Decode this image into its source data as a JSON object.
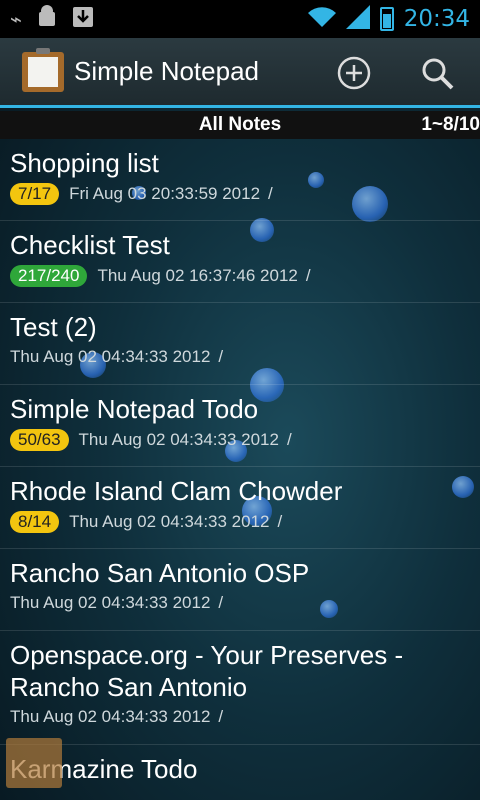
{
  "status_bar": {
    "time": "20:34",
    "icons": [
      "usb-icon",
      "android-debug-icon",
      "download-icon",
      "wifi-icon",
      "signal-icon",
      "battery-icon"
    ]
  },
  "app_bar": {
    "title": "Simple Notepad",
    "add_icon": "plus-circle-icon",
    "search_icon": "search-icon"
  },
  "list_header": {
    "title": "All Notes",
    "count": "1~8/10"
  },
  "notes": [
    {
      "title": "Shopping list",
      "badge": "7/17",
      "badge_color": "yellow",
      "date": "Fri Aug 03 20:33:59 2012",
      "suffix": "/"
    },
    {
      "title": "Checklist Test",
      "badge": "217/240",
      "badge_color": "green",
      "date": "Thu Aug 02 16:37:46 2012",
      "suffix": "/"
    },
    {
      "title": "Test (2)",
      "badge": "",
      "badge_color": "",
      "date": "Thu Aug 02 04:34:33 2012",
      "suffix": "/"
    },
    {
      "title": "Simple Notepad Todo",
      "badge": "50/63",
      "badge_color": "yellow",
      "date": "Thu Aug 02 04:34:33 2012",
      "suffix": "/"
    },
    {
      "title": "Rhode Island Clam Chowder",
      "badge": "8/14",
      "badge_color": "yellow",
      "date": "Thu Aug 02 04:34:33 2012",
      "suffix": "/"
    },
    {
      "title": "Rancho San Antonio OSP",
      "badge": "",
      "badge_color": "",
      "date": "Thu Aug 02 04:34:33 2012",
      "suffix": "/"
    },
    {
      "title": "Openspace.org - Your Preserves - Rancho San Antonio",
      "badge": "",
      "badge_color": "",
      "date": "Thu Aug 02 04:34:33 2012",
      "suffix": "/"
    },
    {
      "title": "Karmazine Todo",
      "badge": "",
      "badge_color": "",
      "date": "",
      "suffix": ""
    }
  ],
  "colors": {
    "accent": "#33b5e5",
    "badge_yellow": "#f3c50f",
    "badge_green": "#2fa73a"
  }
}
